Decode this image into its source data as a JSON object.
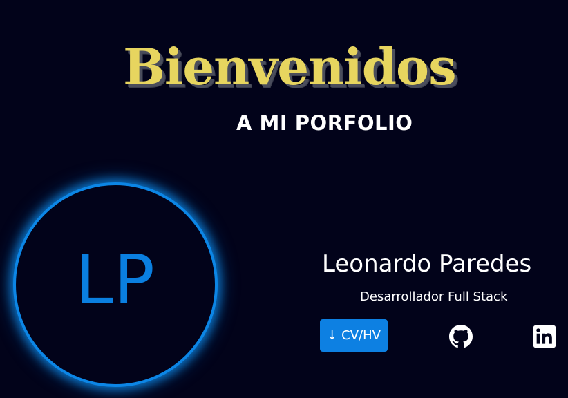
{
  "hero": {
    "title": "Bienvenidos",
    "subtitle": "A MI PORFOLIO"
  },
  "profile": {
    "avatar_initials": "LP",
    "name": "Leonardo Paredes",
    "role": "Desarrollador Full Stack"
  },
  "actions": {
    "cv_icon": "↓",
    "cv_label": "CV/HV"
  },
  "social": {
    "github_icon": "github-icon",
    "linkedin_icon": "linkedin-icon"
  },
  "colors": {
    "background": "#02031a",
    "title": "#e7d55f",
    "accent": "#0d80e2",
    "text": "#ffffff"
  }
}
